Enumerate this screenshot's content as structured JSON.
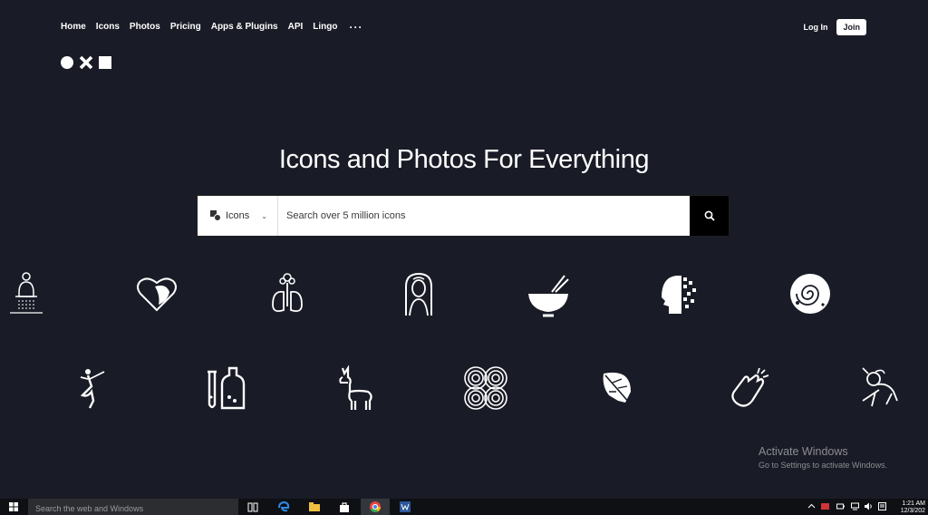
{
  "nav": {
    "items": [
      "Home",
      "Icons",
      "Photos",
      "Pricing",
      "Apps & Plugins",
      "API",
      "Lingo"
    ],
    "more": "···"
  },
  "auth": {
    "login": "Log In",
    "join": "Join"
  },
  "hero": {
    "title": "Icons and Photos For Everything",
    "search_type": "Icons",
    "search_placeholder": "Search over 5 million icons"
  },
  "icons": [
    "meditation-icon",
    "heart-face-icon",
    "lungs-flower-icon",
    "woman-portrait-icon",
    "bowl-chopsticks-icon",
    "pixel-head-icon",
    "brain-swirl-icon",
    "dancer-icon",
    "test-tubes-icon",
    "llama-icon",
    "concentric-pattern-icon",
    "monstera-leaf-icon",
    "clapping-hands-icon",
    "running-animal-icon"
  ],
  "watermark": {
    "title": "Activate Windows",
    "subtitle": "Go to Settings to activate Windows."
  },
  "taskbar": {
    "search_placeholder": "Search the web and Windows",
    "time": "1:21 AM",
    "date": "12/3/202"
  },
  "colors": {
    "background": "#191b26",
    "accent": "#ffffff",
    "search_button": "#000000"
  }
}
